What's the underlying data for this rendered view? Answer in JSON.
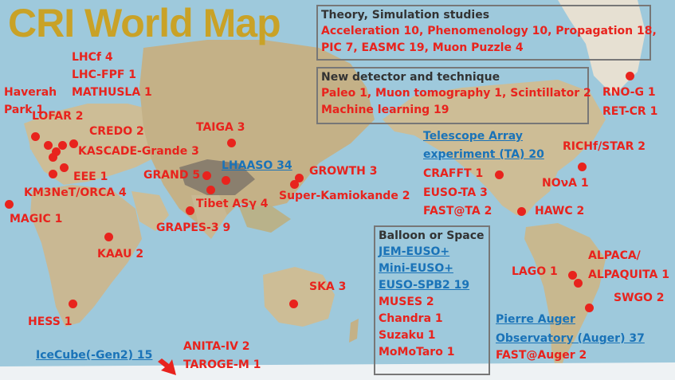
{
  "title": "CRI World Map",
  "theory_box": {
    "heading": "Theory, Simulation studies",
    "line1": "Acceleration 10, Phenomenology 10, Propagation 18,",
    "line2": "PIC 7, EASMC 19, Muon Puzzle 4"
  },
  "detector_box": {
    "heading": "New detector and technique",
    "line1": "Paleo 1, Muon tomography 1, Scintillator 2",
    "line2": "Machine learning 19"
  },
  "space_box": {
    "heading": "Balloon or Space",
    "link1": "JEM-EUSO+",
    "link2": "Mini-EUSO+",
    "link3": "EUSO-SPB2 19",
    "items": [
      "MUSES 2",
      "Chandra 1",
      "Suzaku 1",
      "MoMoTaro 1"
    ]
  },
  "labels": {
    "lhcf": "LHCf 4",
    "lhcfpf": "LHC-FPF 1",
    "mathusla": "MATHUSLA 1",
    "haverah1": "Haverah",
    "haverah2": "Park 1",
    "lofar": "LOFAR 2",
    "credo": "CREDO 2",
    "kascade": "KASCADE-Grande 3",
    "eee": "EEE 1",
    "km3net": "KM3NeT/ORCA 4",
    "magic": "MAGIC 1",
    "kaau": "KAAU 2",
    "hess": "HESS 1",
    "taiga": "TAIGA 3",
    "grand": "GRAND 5",
    "tibet": "Tibet ASγ 4",
    "grapes": "GRAPES-3 9",
    "growth": "GROWTH 3",
    "superk": "Super-Kamiokande 2",
    "ska": "SKA 3",
    "crafft": "CRAFFT 1",
    "eusota": "EUSO-TA 3",
    "fastta": "FAST@TA 2",
    "nova": "NOνA 1",
    "hawc": "HAWC 2",
    "richf": "RICHf/STAR 2",
    "rnog": "RNO-G 1",
    "retcr": "RET-CR 1",
    "lago": "LAGO 1",
    "alpaca1": "ALPACA/",
    "alpaca2": "ALPAQUITA 1",
    "swgo": "SWGO 2",
    "fastauger": "FAST@Auger 2",
    "anita": "ANITA-IV 2",
    "taroge": "TAROGE-M 1"
  },
  "links": {
    "lhaaso": "LHAASO 34",
    "ta1": "Telescope Array",
    "ta2": "experiment (TA) 20",
    "auger1": "Pierre Auger",
    "auger2": "Observatory (Auger) 37",
    "icecube": "IceCube(-Gen2) 15"
  },
  "colors": {
    "title": "#c9a227",
    "label": "#e8231d",
    "link": "#1a73b8",
    "ocean": "#9ec9dc",
    "land": "#cdbd96"
  }
}
